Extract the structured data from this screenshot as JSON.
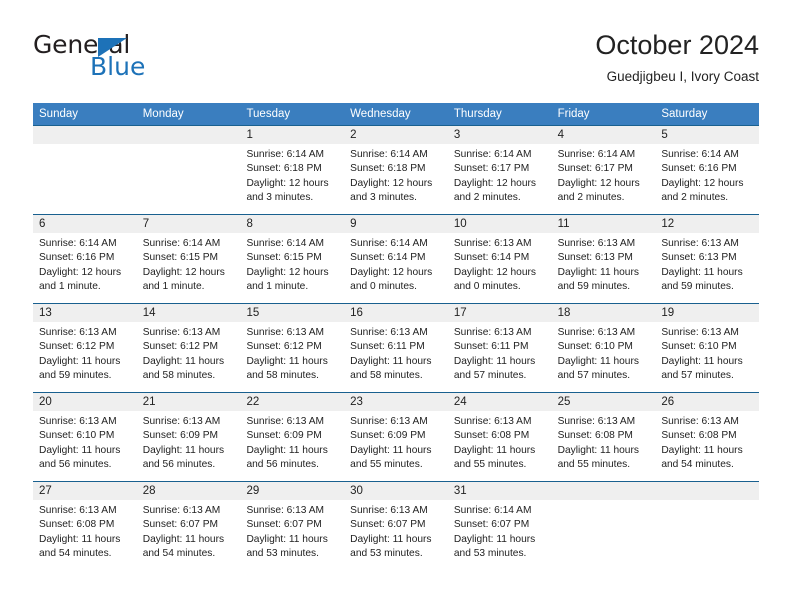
{
  "brand": {
    "name_part1": "General",
    "name_part2": "Blue",
    "triangle_color": "#1d72b8"
  },
  "header": {
    "title": "October 2024",
    "subtitle": "Guedjigbeu I, Ivory Coast"
  },
  "theme": {
    "header_blue": "#3a7ebf",
    "cell_divider_blue": "#19608f",
    "day_band_gray": "#efefef",
    "text": "#222222"
  },
  "weekdays": [
    "Sunday",
    "Monday",
    "Tuesday",
    "Wednesday",
    "Thursday",
    "Friday",
    "Saturday"
  ],
  "weeks": [
    [
      {
        "day": "",
        "sunrise": "",
        "sunset": "",
        "daylight": "",
        "empty": true
      },
      {
        "day": "",
        "sunrise": "",
        "sunset": "",
        "daylight": "",
        "empty": true
      },
      {
        "day": "1",
        "sunrise": "Sunrise: 6:14 AM",
        "sunset": "Sunset: 6:18 PM",
        "daylight": "Daylight: 12 hours and 3 minutes."
      },
      {
        "day": "2",
        "sunrise": "Sunrise: 6:14 AM",
        "sunset": "Sunset: 6:18 PM",
        "daylight": "Daylight: 12 hours and 3 minutes."
      },
      {
        "day": "3",
        "sunrise": "Sunrise: 6:14 AM",
        "sunset": "Sunset: 6:17 PM",
        "daylight": "Daylight: 12 hours and 2 minutes."
      },
      {
        "day": "4",
        "sunrise": "Sunrise: 6:14 AM",
        "sunset": "Sunset: 6:17 PM",
        "daylight": "Daylight: 12 hours and 2 minutes."
      },
      {
        "day": "5",
        "sunrise": "Sunrise: 6:14 AM",
        "sunset": "Sunset: 6:16 PM",
        "daylight": "Daylight: 12 hours and 2 minutes."
      }
    ],
    [
      {
        "day": "6",
        "sunrise": "Sunrise: 6:14 AM",
        "sunset": "Sunset: 6:16 PM",
        "daylight": "Daylight: 12 hours and 1 minute."
      },
      {
        "day": "7",
        "sunrise": "Sunrise: 6:14 AM",
        "sunset": "Sunset: 6:15 PM",
        "daylight": "Daylight: 12 hours and 1 minute."
      },
      {
        "day": "8",
        "sunrise": "Sunrise: 6:14 AM",
        "sunset": "Sunset: 6:15 PM",
        "daylight": "Daylight: 12 hours and 1 minute."
      },
      {
        "day": "9",
        "sunrise": "Sunrise: 6:14 AM",
        "sunset": "Sunset: 6:14 PM",
        "daylight": "Daylight: 12 hours and 0 minutes."
      },
      {
        "day": "10",
        "sunrise": "Sunrise: 6:13 AM",
        "sunset": "Sunset: 6:14 PM",
        "daylight": "Daylight: 12 hours and 0 minutes."
      },
      {
        "day": "11",
        "sunrise": "Sunrise: 6:13 AM",
        "sunset": "Sunset: 6:13 PM",
        "daylight": "Daylight: 11 hours and 59 minutes."
      },
      {
        "day": "12",
        "sunrise": "Sunrise: 6:13 AM",
        "sunset": "Sunset: 6:13 PM",
        "daylight": "Daylight: 11 hours and 59 minutes."
      }
    ],
    [
      {
        "day": "13",
        "sunrise": "Sunrise: 6:13 AM",
        "sunset": "Sunset: 6:12 PM",
        "daylight": "Daylight: 11 hours and 59 minutes."
      },
      {
        "day": "14",
        "sunrise": "Sunrise: 6:13 AM",
        "sunset": "Sunset: 6:12 PM",
        "daylight": "Daylight: 11 hours and 58 minutes."
      },
      {
        "day": "15",
        "sunrise": "Sunrise: 6:13 AM",
        "sunset": "Sunset: 6:12 PM",
        "daylight": "Daylight: 11 hours and 58 minutes."
      },
      {
        "day": "16",
        "sunrise": "Sunrise: 6:13 AM",
        "sunset": "Sunset: 6:11 PM",
        "daylight": "Daylight: 11 hours and 58 minutes."
      },
      {
        "day": "17",
        "sunrise": "Sunrise: 6:13 AM",
        "sunset": "Sunset: 6:11 PM",
        "daylight": "Daylight: 11 hours and 57 minutes."
      },
      {
        "day": "18",
        "sunrise": "Sunrise: 6:13 AM",
        "sunset": "Sunset: 6:10 PM",
        "daylight": "Daylight: 11 hours and 57 minutes."
      },
      {
        "day": "19",
        "sunrise": "Sunrise: 6:13 AM",
        "sunset": "Sunset: 6:10 PM",
        "daylight": "Daylight: 11 hours and 57 minutes."
      }
    ],
    [
      {
        "day": "20",
        "sunrise": "Sunrise: 6:13 AM",
        "sunset": "Sunset: 6:10 PM",
        "daylight": "Daylight: 11 hours and 56 minutes."
      },
      {
        "day": "21",
        "sunrise": "Sunrise: 6:13 AM",
        "sunset": "Sunset: 6:09 PM",
        "daylight": "Daylight: 11 hours and 56 minutes."
      },
      {
        "day": "22",
        "sunrise": "Sunrise: 6:13 AM",
        "sunset": "Sunset: 6:09 PM",
        "daylight": "Daylight: 11 hours and 56 minutes."
      },
      {
        "day": "23",
        "sunrise": "Sunrise: 6:13 AM",
        "sunset": "Sunset: 6:09 PM",
        "daylight": "Daylight: 11 hours and 55 minutes."
      },
      {
        "day": "24",
        "sunrise": "Sunrise: 6:13 AM",
        "sunset": "Sunset: 6:08 PM",
        "daylight": "Daylight: 11 hours and 55 minutes."
      },
      {
        "day": "25",
        "sunrise": "Sunrise: 6:13 AM",
        "sunset": "Sunset: 6:08 PM",
        "daylight": "Daylight: 11 hours and 55 minutes."
      },
      {
        "day": "26",
        "sunrise": "Sunrise: 6:13 AM",
        "sunset": "Sunset: 6:08 PM",
        "daylight": "Daylight: 11 hours and 54 minutes."
      }
    ],
    [
      {
        "day": "27",
        "sunrise": "Sunrise: 6:13 AM",
        "sunset": "Sunset: 6:08 PM",
        "daylight": "Daylight: 11 hours and 54 minutes."
      },
      {
        "day": "28",
        "sunrise": "Sunrise: 6:13 AM",
        "sunset": "Sunset: 6:07 PM",
        "daylight": "Daylight: 11 hours and 54 minutes."
      },
      {
        "day": "29",
        "sunrise": "Sunrise: 6:13 AM",
        "sunset": "Sunset: 6:07 PM",
        "daylight": "Daylight: 11 hours and 53 minutes."
      },
      {
        "day": "30",
        "sunrise": "Sunrise: 6:13 AM",
        "sunset": "Sunset: 6:07 PM",
        "daylight": "Daylight: 11 hours and 53 minutes."
      },
      {
        "day": "31",
        "sunrise": "Sunrise: 6:14 AM",
        "sunset": "Sunset: 6:07 PM",
        "daylight": "Daylight: 11 hours and 53 minutes."
      },
      {
        "day": "",
        "sunrise": "",
        "sunset": "",
        "daylight": "",
        "empty": true
      },
      {
        "day": "",
        "sunrise": "",
        "sunset": "",
        "daylight": "",
        "empty": true
      }
    ]
  ]
}
